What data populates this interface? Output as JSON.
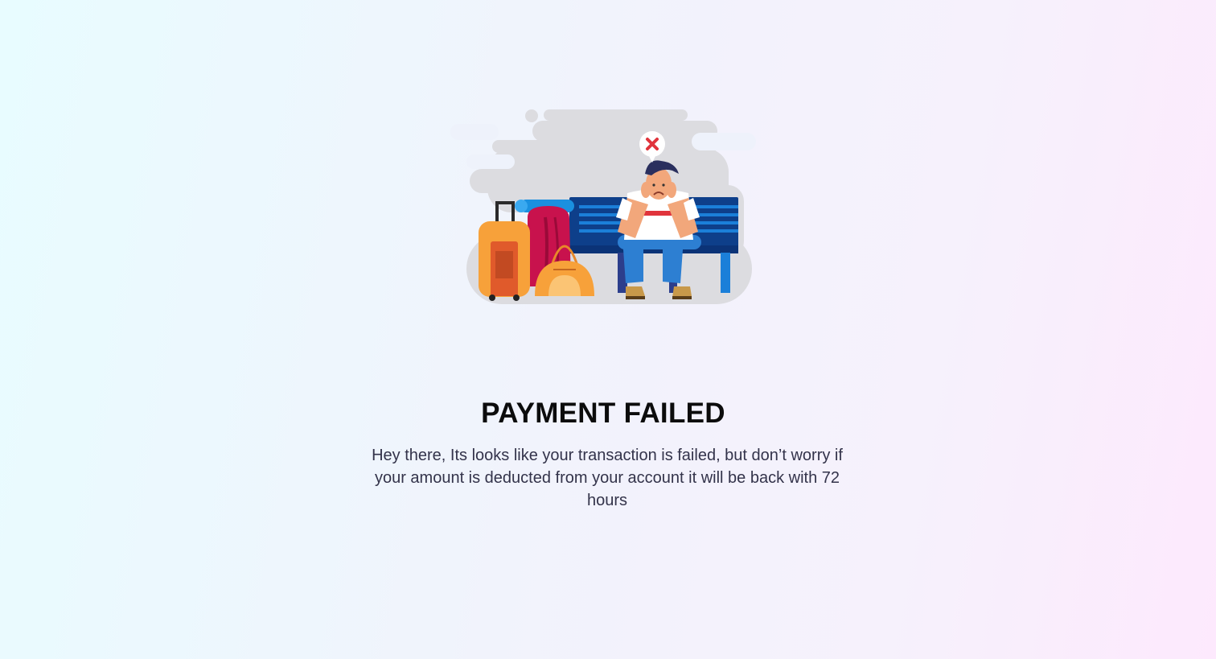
{
  "page": {
    "title": "PAYMENT FAILED",
    "message": "Hey there, Its looks like your transaction is failed, but don’t worry if your amount is deducted from your account it will be back with 72 hours"
  },
  "illustration": {
    "icon": "payment-failed-illustration",
    "status_icon": "error-x-icon",
    "colors": {
      "cloud": "#dcdce0",
      "bench": "#0e3f8a",
      "suitcase": "#f7a13a",
      "backpack": "#c8124d",
      "error": "#e0343c"
    }
  }
}
